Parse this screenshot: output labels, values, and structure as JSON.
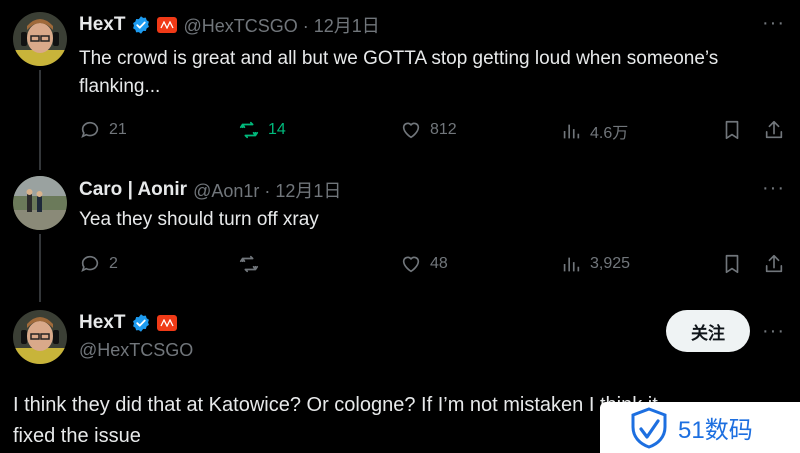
{
  "tweets": [
    {
      "name": "HexT",
      "handle_date": "@HexTCSGO · 12月1日",
      "text_line1": "The crowd is great and all but we GOTTA stop getting loud when someone’s",
      "text_line2": "flanking...",
      "replies": "21",
      "retweets": "14",
      "likes": "812",
      "views": "4.6万",
      "colors": {
        "retweet_active": "#00ba7c",
        "verified": "#1d9bf0",
        "org_badge": "#f03a17"
      }
    },
    {
      "name": "Caro | Aonir",
      "handle_date": "@Aon1r · 12月1日",
      "text": "Yea they should turn off xray",
      "replies": "2",
      "likes": "48",
      "views": "3,925"
    }
  ],
  "main_tweet": {
    "name": "HexT",
    "handle": "@HexTCSGO",
    "follow_label": "关注",
    "text_line1": "I think they did that at Katowice? Or cologne? If I’m not mistaken I think it",
    "text_line2": "fixed the issue"
  },
  "more_label": "···",
  "watermark": {
    "text": "51数码",
    "color": "#1d6fe0"
  }
}
